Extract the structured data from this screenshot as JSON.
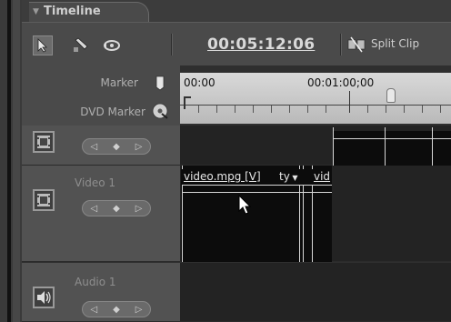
{
  "panel": {
    "title": "Timeline"
  },
  "toolbar": {
    "timecode": "00:05:12:06",
    "split_clip_label": "Split Clip"
  },
  "ruler": {
    "marker_label": "Marker",
    "dvd_marker_label": "DVD Marker",
    "time_start": "00:00",
    "time_mid": "00:01:00;00"
  },
  "tracks": [
    {
      "name": ""
    },
    {
      "name": "Video 1"
    },
    {
      "name": "Audio 1"
    }
  ],
  "clip": {
    "label": "video.mpg [V]",
    "dropdown": "ty",
    "next_clip_label": "vid"
  },
  "icons": {
    "selection_tool": "arrow-icon",
    "razor_tool": "razor-icon",
    "zoom_tool": "zoom-icon",
    "split_clip": "split-clip-icon",
    "marker": "marker-icon",
    "dvd_marker": "dvd-marker-icon",
    "video_track": "filmstrip-icon",
    "audio_track": "speaker-icon"
  }
}
